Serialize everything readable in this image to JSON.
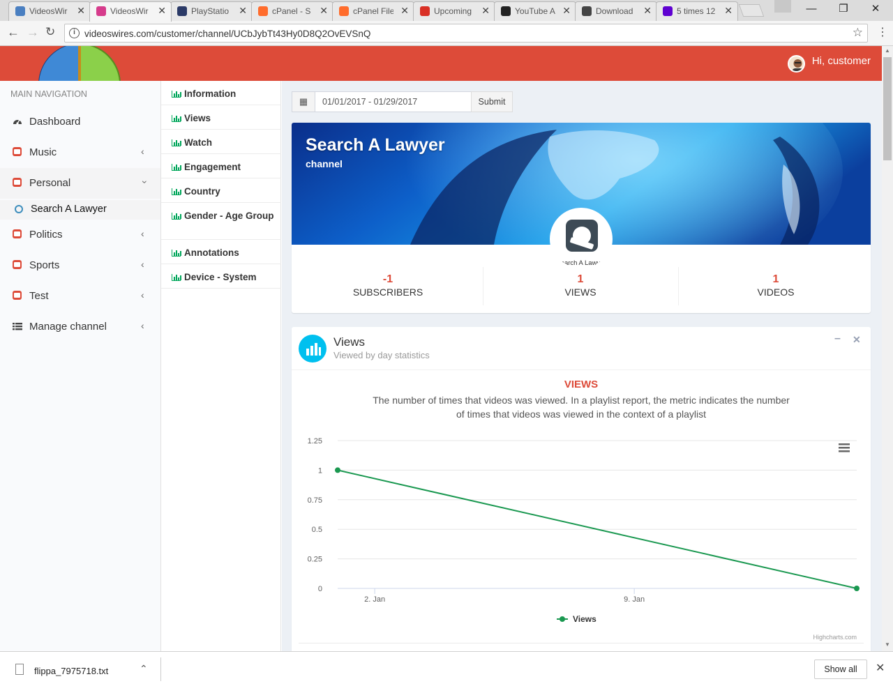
{
  "browser": {
    "tabs": [
      {
        "label": "VideosWir",
        "icon": "spiral-icon",
        "color": "#4a7fc1"
      },
      {
        "label": "VideosWir",
        "icon": "tv-icon",
        "color": "#d63c8c"
      },
      {
        "label": "PlayStatio",
        "icon": "playstation-icon",
        "color": "#2b3a67"
      },
      {
        "label": "cPanel - S",
        "icon": "cpanel-icon",
        "color": "#ff6c2c"
      },
      {
        "label": "cPanel File",
        "icon": "cpanel-icon",
        "color": "#ff6c2c"
      },
      {
        "label": "Upcoming",
        "icon": "gmail-icon",
        "color": "#d93025"
      },
      {
        "label": "YouTube A",
        "icon": "bh-icon",
        "color": "#222222"
      },
      {
        "label": "Download",
        "icon": "download-icon",
        "color": "#444444"
      },
      {
        "label": "5 times 12",
        "icon": "yahoo-icon",
        "color": "#5f01d1"
      }
    ],
    "url": "videoswires.com/customer/channel/UCbJybTt43Hy0D8Q2OvEVSnQ"
  },
  "header": {
    "greeting": "Hi, customer",
    "accent": "#dd4b39"
  },
  "nav": {
    "heading": "MAIN NAVIGATION",
    "items": [
      {
        "label": "Dashboard",
        "icon": "dashboard-icon"
      },
      {
        "label": "Music",
        "icon": "youtube-icon"
      },
      {
        "label": "Personal",
        "icon": "youtube-icon"
      },
      {
        "label": "Politics",
        "icon": "youtube-icon"
      },
      {
        "label": "Sports",
        "icon": "youtube-icon"
      },
      {
        "label": "Test",
        "icon": "youtube-icon"
      },
      {
        "label": "Manage channel",
        "icon": "list-icon"
      }
    ],
    "sub_item": "Search A Lawyer"
  },
  "submenu": [
    "Information",
    "Views",
    "Watch",
    "Engagement",
    "Country",
    "Gender - Age Group",
    "Annotations",
    "Device - System"
  ],
  "filter": {
    "date_range": "01/01/2017 - 01/29/2017",
    "submit_label": "Submit"
  },
  "channel": {
    "name": "Search A Lawyer",
    "subtitle": "channel",
    "avatar_caption": "Search A Lawyer",
    "stats": [
      {
        "value": "-1",
        "label": "SUBSCRIBERS"
      },
      {
        "value": "1",
        "label": "VIEWS"
      },
      {
        "value": "1",
        "label": "VIDEOS"
      }
    ]
  },
  "views_box": {
    "title": "Views",
    "subtitle": "Viewed by day statistics",
    "chart_title": "VIEWS",
    "chart_subtitle": "The number of times that videos was viewed. In a playlist report, the metric indicates the number of times that videos was viewed in the context of a playlist",
    "credits": "Highcharts.com"
  },
  "chart_data": {
    "type": "line",
    "title": "VIEWS",
    "subtitle": "The number of times that videos was viewed. In a playlist report, the metric indicates the number of times that videos was viewed in the context of a playlist",
    "x": [
      "2017-01-01",
      "2017-01-15"
    ],
    "x_tick_labels": [
      "2. Jan",
      "9. Jan"
    ],
    "x_tick_dates": [
      "2017-01-02",
      "2017-01-09"
    ],
    "xlim": [
      "2017-01-01",
      "2017-01-15"
    ],
    "series": [
      {
        "name": "Views",
        "values": [
          1,
          0
        ],
        "color": "#1a9850"
      }
    ],
    "yticks": [
      "0",
      "0.25",
      "0.5",
      "0.75",
      "1",
      "1.25"
    ],
    "ylim": [
      0,
      1.25
    ],
    "grid": true,
    "legend": "bottom-center"
  },
  "downloads": {
    "file": "flippa_7975718.txt",
    "show_all": "Show all"
  }
}
